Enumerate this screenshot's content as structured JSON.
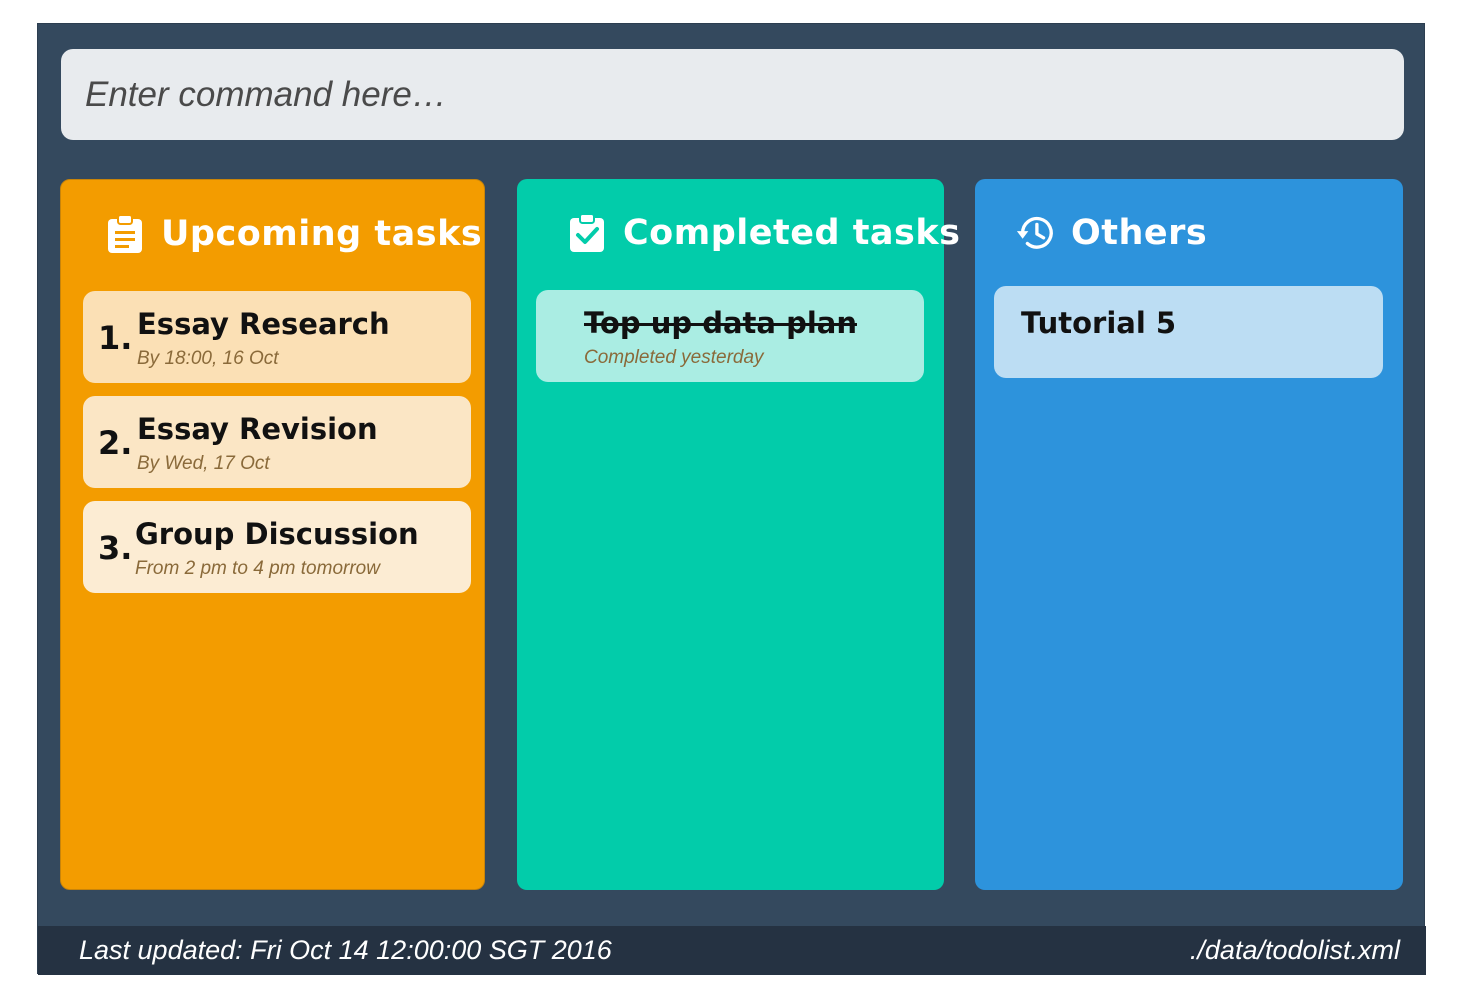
{
  "command": {
    "placeholder": "Enter command here…"
  },
  "panels": {
    "upcoming": {
      "title": "Upcoming tasks",
      "icon": "clipboard-list-icon",
      "color": "#f39c00",
      "tasks": [
        {
          "number": "1.",
          "title": "Essay Research",
          "subtitle": "By 18:00, 16 Oct"
        },
        {
          "number": "2.",
          "title": "Essay Revision",
          "subtitle": "By Wed, 17 Oct"
        },
        {
          "number": "3.",
          "title": "Group Discussion",
          "subtitle": "From 2 pm to 4 pm tomorrow"
        }
      ]
    },
    "completed": {
      "title": "Completed tasks",
      "icon": "clipboard-check-icon",
      "color": "#02ccaa",
      "tasks": [
        {
          "title": "Top up data plan",
          "subtitle": "Completed yesterday"
        }
      ]
    },
    "others": {
      "title": "Others",
      "icon": "history-icon",
      "color": "#2d93dc",
      "tasks": [
        {
          "title": "Tutorial 5"
        }
      ]
    }
  },
  "status": {
    "last_updated": "Last updated: Fri Oct 14 12:00:00 SGT 2016",
    "file_path": "./data/todolist.xml"
  }
}
